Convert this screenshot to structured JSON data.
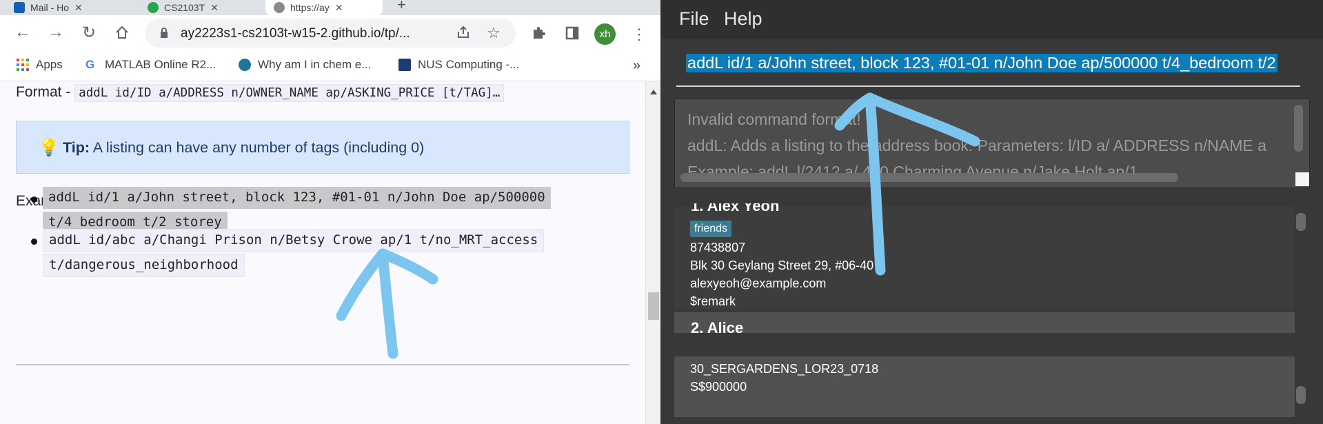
{
  "browser": {
    "tabs": [
      {
        "label": "Mail - Ho",
        "color": "#0f62b5"
      },
      {
        "label": "CS2103T",
        "color": "#2aa34a"
      },
      {
        "label": "https://ay",
        "color": "#777777"
      }
    ],
    "url": "ay2223s1-cs2103t-w15-2.github.io/tp/...",
    "avatar_initials": "xh",
    "bookmarks": [
      {
        "label": "Apps",
        "icon": "apps-grid-icon"
      },
      {
        "label": "MATLAB Online R2...",
        "icon": "google-icon"
      },
      {
        "label": "Why am I in chem e...",
        "icon": "wordpress-icon"
      },
      {
        "label": "NUS Computing -...",
        "icon": "nus-icon"
      }
    ],
    "bookmarks_overflow": "»",
    "page": {
      "format_label": "Format - ",
      "format_code": "addL id/ID a/ADDRESS n/OWNER_NAME ap/ASKING_PRICE [t/TAG]…",
      "tip_label": "Tip:",
      "tip_text": " A listing can have any number of tags (including 0)",
      "examples_label": "Examples:",
      "example1_line1": "addL id/1 a/John street, block 123, #01-01 n/John Doe ap/500000",
      "example1_line2": "t/4_bedroom t/2_storey",
      "example2_line1": "addL id/abc a/Changi Prison n/Betsy Crowe ap/1 t/no_MRT_access",
      "example2_line2": "t/dangerous_neighborhood"
    }
  },
  "app": {
    "menu": {
      "file": "File",
      "help": "Help"
    },
    "command_text": "addL id/1 a/John street, block 123, #01-01 n/John Doe ap/500000 t/4_bedroom t/2",
    "result_lines": [
      "Invalid command format!",
      "addL: Adds a listing to the address book. Parameters: l/ID a/ ADDRESS n/NAME a",
      "Example: addL l/2412 a/ 420 Charming Avenue n/Jake Holt ap/1"
    ],
    "persons": [
      {
        "name": "1.  Alex Yeoh",
        "tag": "friends",
        "phone": "87438807",
        "address": "Blk 30 Geylang Street 29, #06-40",
        "email": "alexyeoh@example.com",
        "remark": "$remark"
      },
      {
        "name": "2.  Alice"
      }
    ],
    "listing": {
      "id": "30_SERGARDENS_LOR23_0718",
      "price": "S$900000"
    }
  },
  "colors": {
    "selection": "#0c7db8",
    "annotation": "#7cc5ef",
    "tag": "#3e7b91"
  }
}
